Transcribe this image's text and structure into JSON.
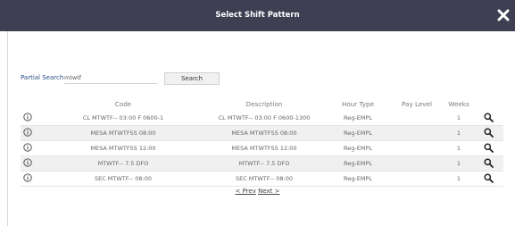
{
  "dialog": {
    "title": "Select Shift Pattern",
    "close_icon": "close-x-icon"
  },
  "search": {
    "label": "Partial Search",
    "value": "mtwtf",
    "button_label": "Search"
  },
  "table": {
    "headers": [
      "Code",
      "Description",
      "Hour Type",
      "Pay Level",
      "Weeks"
    ],
    "rows": [
      {
        "code": "CL MTWTF-- 03:00 F 0600-1",
        "description": "CL MTWTF-- 03:00 F 0600-1300",
        "hour_type": "Reg-EMPL",
        "pay_level": "",
        "weeks": "1"
      },
      {
        "code": "MESA MTWTFSS 08:00",
        "description": "MESA MTWTFSS 08:00",
        "hour_type": "Reg-EMPL",
        "pay_level": "",
        "weeks": "1"
      },
      {
        "code": "MESA MTWTFSS 12:00",
        "description": "MESA MTWTFSS 12:00",
        "hour_type": "Reg-EMPL",
        "pay_level": "",
        "weeks": "1"
      },
      {
        "code": "MTWTF-- 7.5 DFO",
        "description": "MTWTF-- 7.5 DFO",
        "hour_type": "Reg-EMPL",
        "pay_level": "",
        "weeks": "1"
      },
      {
        "code": "SEC MTWTF-- 08:00",
        "description": "SEC MTWTF-- 08:00",
        "hour_type": "Reg-EMPL",
        "pay_level": "",
        "weeks": "1"
      }
    ],
    "row_info_icon": "info-circle-icon",
    "row_select_icon": "magnifier-icon"
  },
  "pager": {
    "prev_label": "< Prev",
    "next_label": "Next >"
  },
  "colors": {
    "titlebar": "#3e3f52",
    "search_label": "#2c4f86",
    "alt_row": "#f0f0f0"
  }
}
